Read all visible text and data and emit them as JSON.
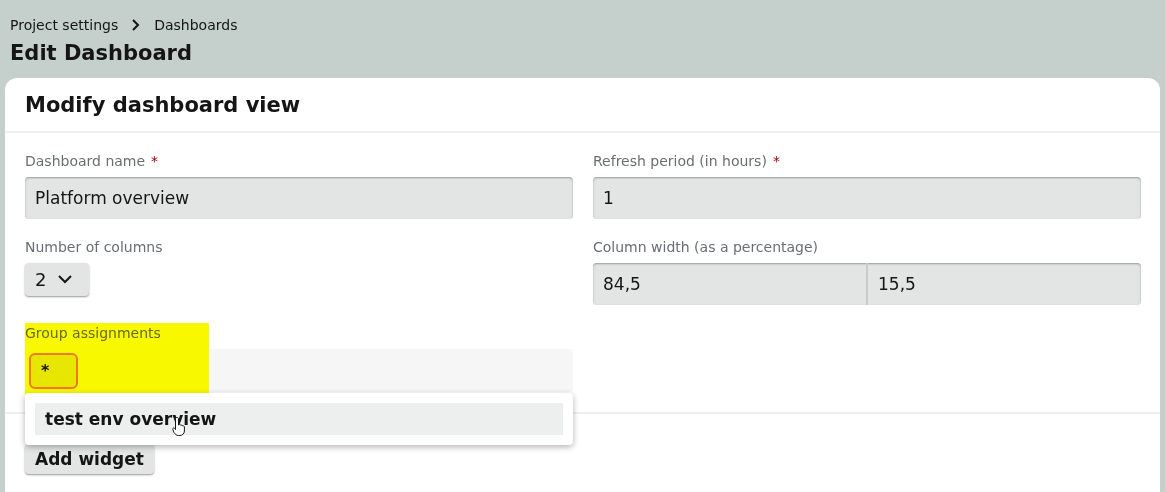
{
  "breadcrumb": [
    {
      "label": "Project settings"
    },
    {
      "label": "Dashboards"
    }
  ],
  "page_title": "Edit Dashboard",
  "card": {
    "title": "Modify dashboard view",
    "fields": [
      {
        "kind": "text",
        "label": "Dashboard name",
        "required": true,
        "value": "Platform overview"
      },
      {
        "kind": "text",
        "label": "Refresh period (in hours)",
        "required": true,
        "value": "1"
      },
      {
        "kind": "select",
        "label": "Number of columns",
        "required": false,
        "value": "2"
      },
      {
        "kind": "split",
        "label": "Column width (as a percentage)",
        "required": false,
        "values": [
          "84,5",
          "15,5"
        ]
      }
    ],
    "group_assignments": {
      "label": "Group assignments",
      "highlighted": true,
      "chips": [
        {
          "label": "*"
        }
      ],
      "suggestions": [
        {
          "label": "test env overview",
          "hovered": true
        }
      ]
    },
    "add_button": "Add widget"
  }
}
